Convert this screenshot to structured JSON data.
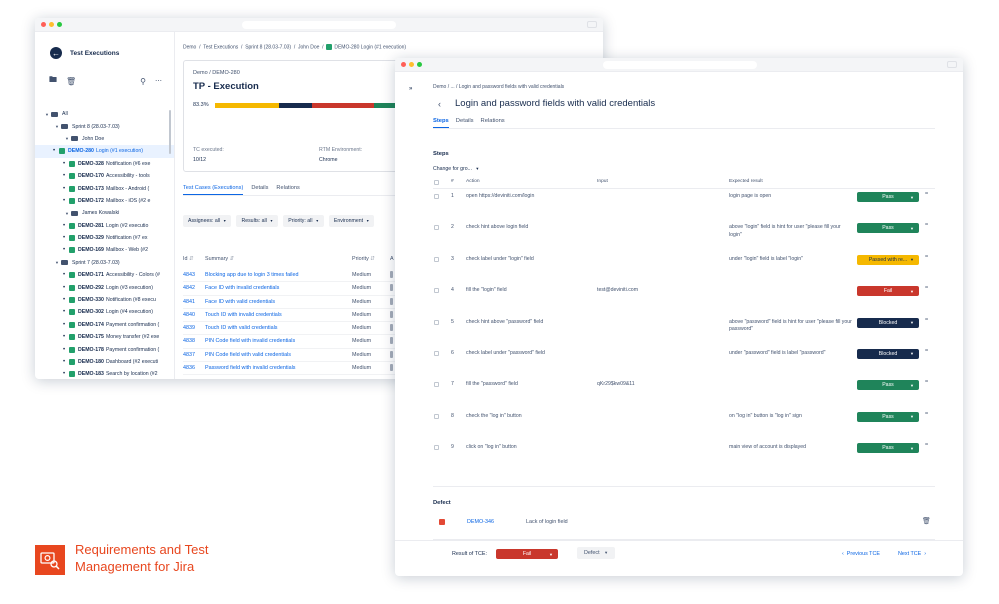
{
  "back_window": {
    "sidebar": {
      "title": "Test Executions",
      "tree": [
        {
          "kind": "group",
          "depth": 0,
          "label": "All"
        },
        {
          "kind": "group",
          "depth": 1,
          "label": "Sprint 8 (28.03-7.03)"
        },
        {
          "kind": "group",
          "depth": 2,
          "label": "John Doe"
        },
        {
          "kind": "item",
          "key": "DEMO-280",
          "label": "Login (#1 execution)",
          "selected": true
        },
        {
          "kind": "item",
          "key": "DEMO-328",
          "label": "Notification (#6 exe"
        },
        {
          "kind": "item",
          "key": "DEMO-170",
          "label": "Accessibility - tools"
        },
        {
          "kind": "item",
          "key": "DEMO-173",
          "label": "Mailbox - Android ("
        },
        {
          "kind": "item",
          "key": "DEMO-172",
          "label": "Mailbox - iOS (#2 e"
        },
        {
          "kind": "group",
          "depth": 2,
          "label": "James Kowalski"
        },
        {
          "kind": "item",
          "key": "DEMO-281",
          "label": "Login (#2 executio"
        },
        {
          "kind": "item",
          "key": "DEMO-329",
          "label": "Notification (#7 ex"
        },
        {
          "kind": "item",
          "key": "DEMO-169",
          "label": "Mailbox - Web (#2"
        },
        {
          "kind": "group",
          "depth": 1,
          "label": "Sprint 7 (28.03-7.03)"
        },
        {
          "kind": "item",
          "key": "DEMO-171",
          "label": "Accessibility - Colors (#"
        },
        {
          "kind": "item",
          "key": "DEMO-292",
          "label": "Login (#3 execution)"
        },
        {
          "kind": "item",
          "key": "DEMO-330",
          "label": "Notification (#8 execu"
        },
        {
          "kind": "item",
          "key": "DEMO-302",
          "label": "Login (#4 execution)"
        },
        {
          "kind": "item",
          "key": "DEMO-174",
          "label": "Payment confirmation ("
        },
        {
          "kind": "item",
          "key": "DEMO-175",
          "label": "Money transfer (#2 exe"
        },
        {
          "kind": "item",
          "key": "DEMO-178",
          "label": "Payment confirmation ("
        },
        {
          "kind": "item",
          "key": "DEMO-180",
          "label": "Dashboard (#2 executi"
        },
        {
          "kind": "item",
          "key": "DEMO-183",
          "label": "Search by location (#2"
        }
      ]
    },
    "breadcrumb": [
      "Demo",
      "Test Executions",
      "Sprint 8 (28.03-7.03)",
      "John Doe",
      "DEMO-280 Login (#1 execution)"
    ],
    "card": {
      "breadcrumb": "Demo  /  DEMO-280",
      "title": "TP - Execution",
      "progress_label": "83.3%",
      "progress_segments": [
        {
          "color": "#f5b800",
          "fraction": 0.34
        },
        {
          "color": "#172b4d",
          "fraction": 0.17
        },
        {
          "color": "#c9372c",
          "fraction": 0.33
        },
        {
          "color": "#1f845a",
          "fraction": 0.16
        }
      ],
      "tc_executed_label": "TC executed:",
      "tc_executed_value": "10/12",
      "rtm_label": "RTM Environment:",
      "rtm_value": "Chrome"
    },
    "tabs": [
      "Test Cases (Executions)",
      "Details",
      "Relations"
    ],
    "filters": [
      "Assignees: all",
      "Results: all",
      "Priority: all",
      "Environment"
    ],
    "columns": {
      "id": "Id",
      "summary": "Summary",
      "priority": "Priority",
      "a": "A"
    },
    "rows": [
      {
        "id": "4843",
        "summary": "Blocking app due to login 3 times failed",
        "priority": "Medium"
      },
      {
        "id": "4842",
        "summary": "Face ID with invalid credentials",
        "priority": "Medium"
      },
      {
        "id": "4841",
        "summary": "Face ID with valid credentials",
        "priority": "Medium"
      },
      {
        "id": "4840",
        "summary": "Touch ID with invalid credentials",
        "priority": "Medium"
      },
      {
        "id": "4839",
        "summary": "Touch ID with valid credentials",
        "priority": "Medium"
      },
      {
        "id": "4838",
        "summary": "PIN Code field with invalid credentials",
        "priority": "Medium"
      },
      {
        "id": "4837",
        "summary": "PIN Code field with valid credentials",
        "priority": "Medium"
      },
      {
        "id": "4836",
        "summary": "Password field with invalid credentials",
        "priority": "Medium"
      }
    ]
  },
  "front_window": {
    "breadcrumb": "Demo  /  ...  /  Login and password fields with valid credentials",
    "title": "Login and password fields with valid credentials",
    "tabs": [
      "Steps",
      "Details",
      "Relations"
    ],
    "steps_title": "Steps",
    "change_group": "Change for gro...",
    "columns": {
      "num": "#",
      "action": "Action",
      "input": "Input",
      "expected": "Expected result"
    },
    "steps": [
      {
        "num": "1",
        "action": "open https://deviniti.com/login",
        "input": "",
        "expected": "login page is open",
        "status": "Pass",
        "color": "#1f845a"
      },
      {
        "num": "2",
        "action": "check hint above login field",
        "input": "",
        "expected": "above \"login\" field is hint for user \"please fill your login\"",
        "status": "Pass",
        "color": "#1f845a"
      },
      {
        "num": "3",
        "action": "check label under \"login\" field",
        "input": "",
        "expected": "under \"login\" field is label \"login\"",
        "status": "Passed with re...",
        "color": "#f5b800",
        "dark_text": true
      },
      {
        "num": "4",
        "action": "fill the \"login\" field",
        "input": "test@deviniti.com",
        "expected": "",
        "status": "Fail",
        "color": "#c9372c"
      },
      {
        "num": "5",
        "action": "check hint above \"password\" field",
        "input": "",
        "expected": "above \"password\" field is hint for user \"please fill your password\"",
        "status": "Blocked",
        "color": "#172b4d"
      },
      {
        "num": "6",
        "action": "check label under \"password\" field",
        "input": "",
        "expected": "under \"password\" field is label \"password\"",
        "status": "Blocked",
        "color": "#172b4d"
      },
      {
        "num": "7",
        "action": "fill the \"password\" field",
        "input": "qKr29$kw09&11",
        "expected": "",
        "status": "Pass",
        "color": "#1f845a"
      },
      {
        "num": "8",
        "action": "check the \"log in\" button",
        "input": "",
        "expected": "on \"log in\" button is \"log in\" sign",
        "status": "Pass",
        "color": "#1f845a"
      },
      {
        "num": "9",
        "action": "click on \"log in\" button",
        "input": "",
        "expected": "main view of account is displayed",
        "status": "Pass",
        "color": "#1f845a"
      }
    ],
    "defect": {
      "title": "Defect",
      "key": "DEMO-346",
      "summary": "Lack of login field"
    },
    "footer": {
      "result_label": "Result of TCE:",
      "result_value": "Fail",
      "result_color": "#c9372c",
      "defect_button": "Defect",
      "prev": "Previous TCE",
      "next": "Next TCE"
    }
  },
  "brand": {
    "line1": "Requirements and Test",
    "line2_bold": "Management",
    "line2_light": " for Jira",
    "color": "#e8471f"
  }
}
